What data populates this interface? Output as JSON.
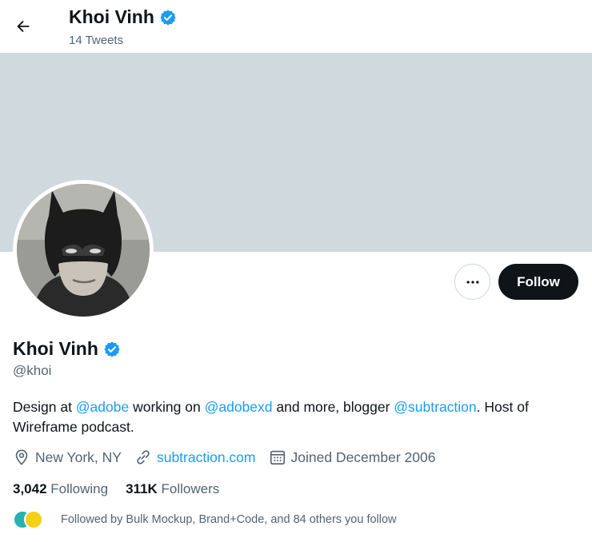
{
  "header": {
    "name": "Khoi Vinh",
    "tweet_count": "14 Tweets"
  },
  "profile": {
    "name": "Khoi Vinh",
    "handle": "@khoi",
    "follow_label": "Follow",
    "bio": {
      "p1": "Design at ",
      "link1": "@adobe",
      "p2": " working on ",
      "link2": "@adobexd",
      "p3": " and more, blogger ",
      "link3": "@subtraction",
      "p4": ". Host of Wireframe podcast."
    },
    "location": "New York, NY",
    "website": "subtraction.com",
    "joined": "Joined December 2006",
    "following_count": "3,042",
    "following_label": "Following",
    "followers_count": "311K",
    "followers_label": "Followers",
    "followed_by": "Followed by Bulk Mockup, Brand+Code, and 84 others you follow"
  },
  "colors": {
    "accent": "#1d9bf0",
    "banner": "#cfd9de",
    "text": "#0f1419",
    "muted": "#536471"
  },
  "icons": {
    "back": "arrow-left-icon",
    "verified": "verified-badge-icon",
    "more": "more-horizontal-icon",
    "location": "location-pin-icon",
    "link": "link-icon",
    "calendar": "calendar-icon"
  }
}
